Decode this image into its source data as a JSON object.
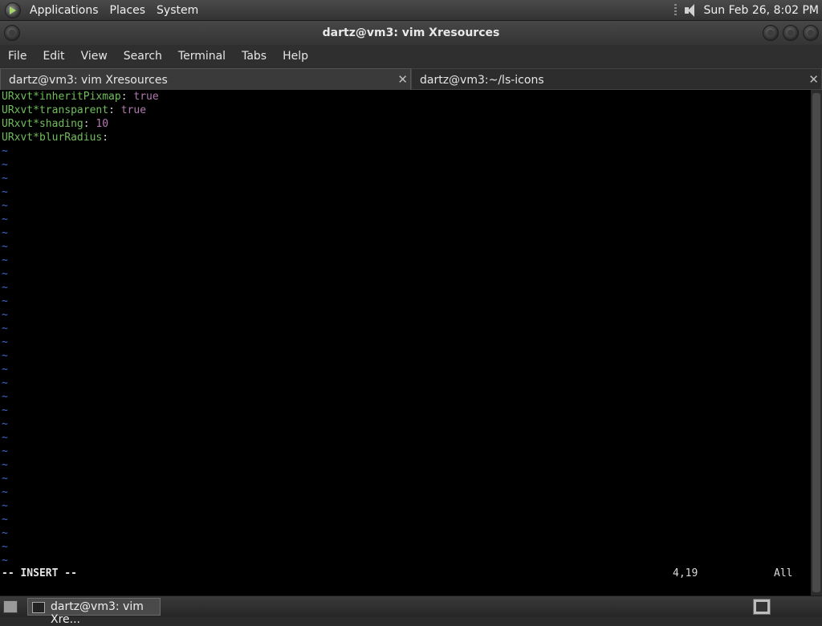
{
  "top_panel": {
    "menus": [
      "Applications",
      "Places",
      "System"
    ],
    "clock": "Sun Feb 26,  8:02 PM"
  },
  "window": {
    "title": "dartz@vm3: vim Xresources"
  },
  "menubar": [
    "File",
    "Edit",
    "View",
    "Search",
    "Terminal",
    "Tabs",
    "Help"
  ],
  "tabs": [
    {
      "label": "dartz@vm3: vim Xresources",
      "close": "✕"
    },
    {
      "label": "dartz@vm3:~/ls-icons",
      "close": "✕"
    }
  ],
  "terminal": {
    "lines": [
      {
        "key": "URxvt*inheritPixmap",
        "sep": ": ",
        "val": "true"
      },
      {
        "key": "URxvt*transparent",
        "sep": ": ",
        "val": "true"
      },
      {
        "key": "URxvt*shading",
        "sep": ": ",
        "val": "10"
      },
      {
        "key": "URxvt*blurRadius",
        "sep": ":",
        "val": ""
      }
    ],
    "tilde": "~",
    "tilde_count": 31,
    "mode": "-- INSERT --",
    "position": "4,19",
    "scroll_state": "All"
  },
  "taskbar": {
    "task_label": "dartz@vm3: vim Xre..."
  },
  "colors": {
    "key": "#6fbf5a",
    "value": "#b07ab0",
    "tilde": "#3c6fcf"
  },
  "icons": [
    "gnome-logo-icon",
    "volume-icon",
    "close-icon",
    "terminal-icon",
    "workspace-icon",
    "show-desktop-icon"
  ]
}
